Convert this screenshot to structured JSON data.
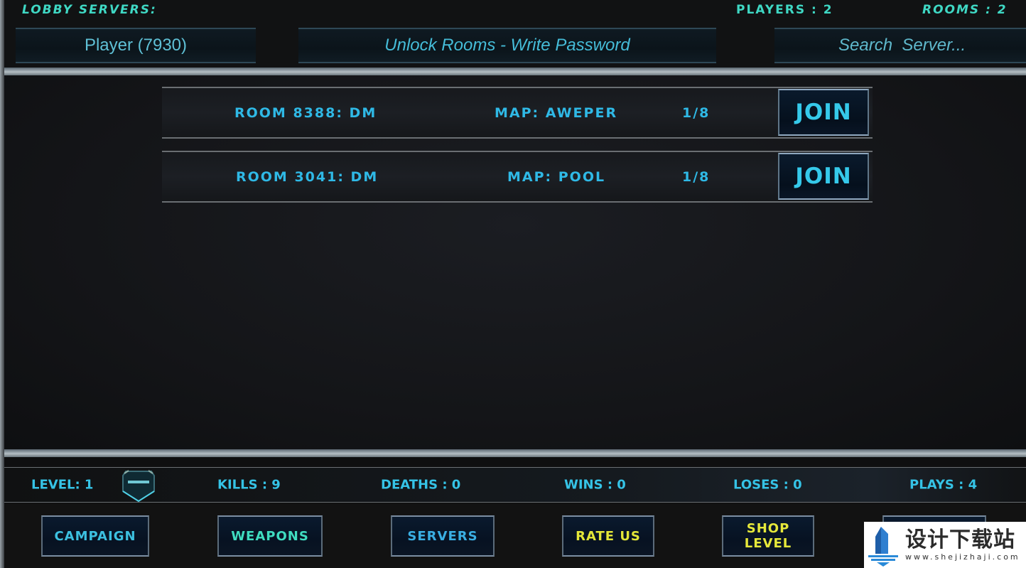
{
  "header": {
    "lobby_title": "LOBBY SERVERS:",
    "players_count": "PLAYERS : 2",
    "rooms_count": "ROOMS : 2"
  },
  "inputs": {
    "player_name": {
      "value": "Player (7930)"
    },
    "password": {
      "placeholder": "Unlock Rooms - Write Password"
    },
    "search": {
      "placeholder": "Search  Server..."
    }
  },
  "rooms": [
    {
      "name": "ROOM 8388: DM",
      "map": "MAP: AWEPER",
      "players": "1/8",
      "join_label": "JOIN"
    },
    {
      "name": "ROOM 3041: DM",
      "map": "MAP: POOL",
      "players": "1/8",
      "join_label": "JOIN"
    }
  ],
  "stats": {
    "level": "LEVEL: 1",
    "rank_icon": "rank-badge-icon",
    "kills": "KILLS : 9",
    "deaths": "DEATHS : 0",
    "wins": "WINS : 0",
    "loses": "LOSES : 0",
    "plays": "PLAYS : 4"
  },
  "nav": {
    "campaign": "CAMPAIGN",
    "weapons": "WEAPONS",
    "servers": "SERVERS",
    "rate_us": "RATE US",
    "shop_line1": "SHOP",
    "shop_line2": "LEVEL"
  },
  "colors": {
    "header_teal": "#3fd8c4",
    "text_cyan": "#2fb9e6",
    "button_yellow": "#e3e638",
    "background": "#121212"
  },
  "watermark": {
    "title": "设计下载站",
    "url": "www.shejizhaji.com"
  }
}
